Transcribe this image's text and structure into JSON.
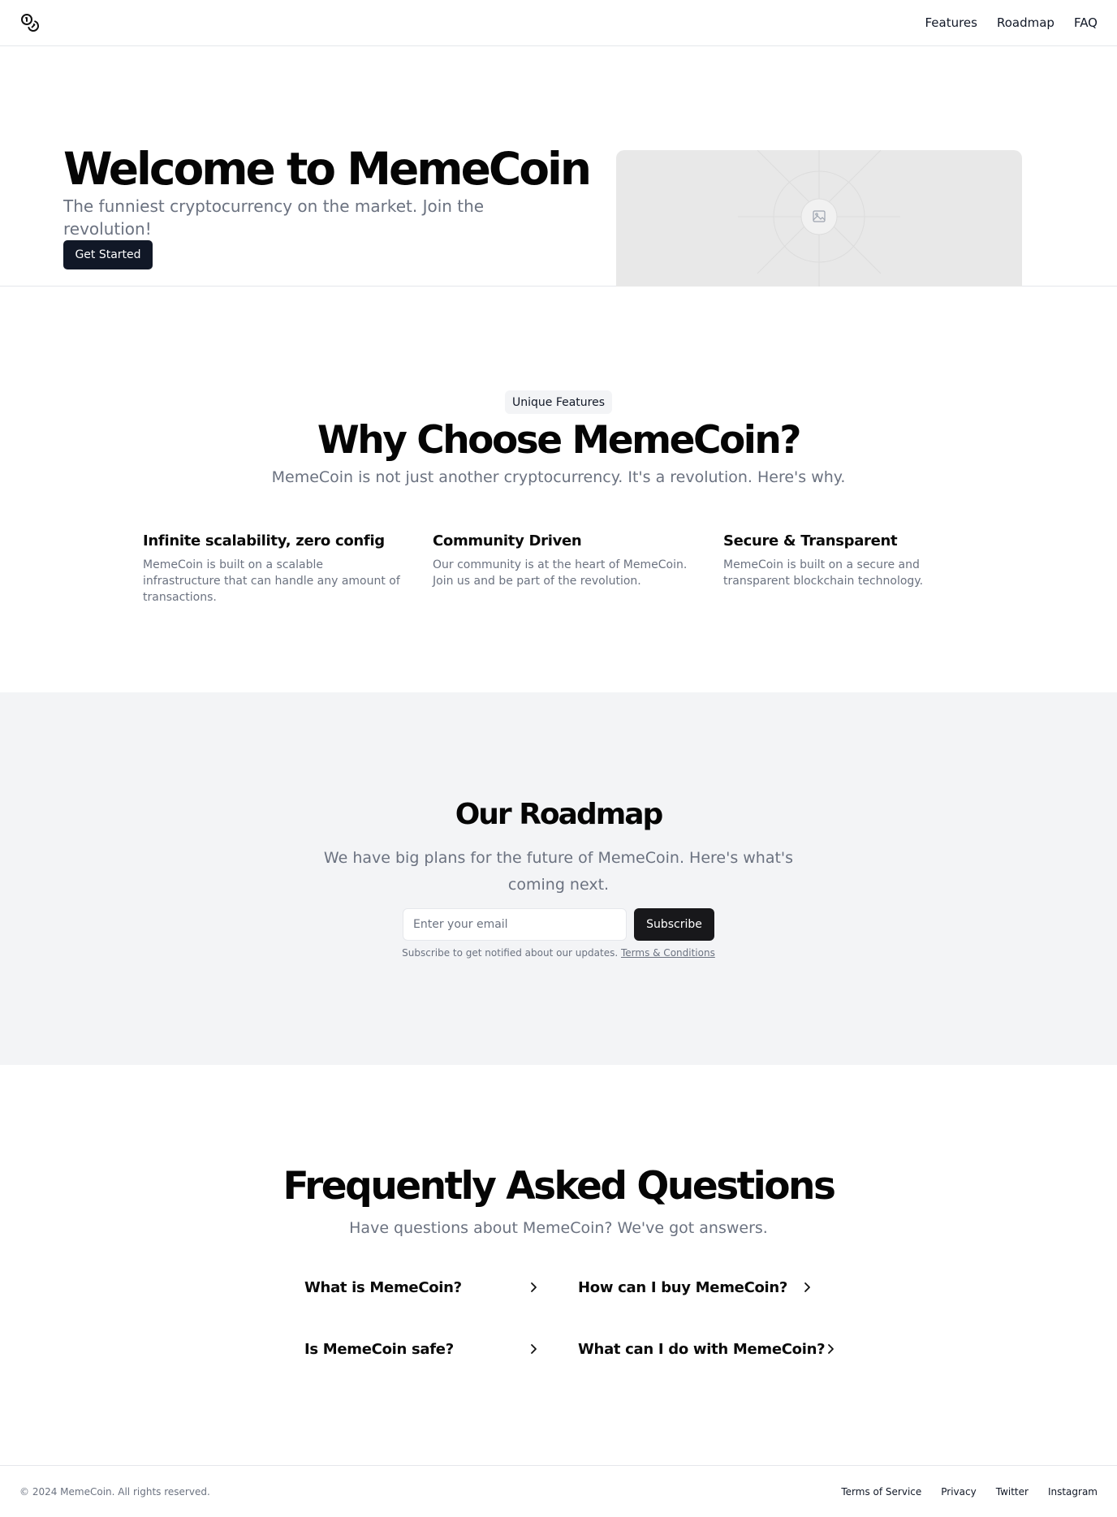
{
  "header": {
    "logo_icon": "coins-icon",
    "nav": [
      "Features",
      "Roadmap",
      "FAQ"
    ]
  },
  "hero": {
    "title": "Welcome to MemeCoin",
    "subtitle": "The funniest cryptocurrency on the market. Join the revolution!",
    "cta": "Get Started",
    "image_icon": "image-placeholder-icon"
  },
  "features": {
    "badge": "Unique Features",
    "title": "Why Choose MemeCoin?",
    "subtitle": "MemeCoin is not just another cryptocurrency. It's a revolution. Here's why.",
    "items": [
      {
        "title": "Infinite scalability, zero config",
        "text": "MemeCoin is built on a scalable infrastructure that can handle any amount of transactions."
      },
      {
        "title": "Community Driven",
        "text": "Our community is at the heart of MemeCoin. Join us and be part of the revolution."
      },
      {
        "title": "Secure & Transparent",
        "text": "MemeCoin is built on a secure and transparent blockchain technology."
      }
    ]
  },
  "roadmap": {
    "title": "Our Roadmap",
    "subtitle": "We have big plans for the future of MemeCoin. Here's what's coming next.",
    "email_placeholder": "Enter your email",
    "subscribe": "Subscribe",
    "note": "Subscribe to get notified about our updates.",
    "terms": "Terms & Conditions"
  },
  "faq": {
    "title": "Frequently Asked Questions",
    "subtitle": "Have questions about MemeCoin? We've got answers.",
    "questions": [
      "What is MemeCoin?",
      "How can I buy MemeCoin?",
      "Is MemeCoin safe?",
      "What can I do with MemeCoin?"
    ]
  },
  "footer": {
    "copyright": "© 2024 MemeCoin. All rights reserved.",
    "links": [
      "Terms of Service",
      "Privacy",
      "Twitter",
      "Instagram"
    ]
  }
}
